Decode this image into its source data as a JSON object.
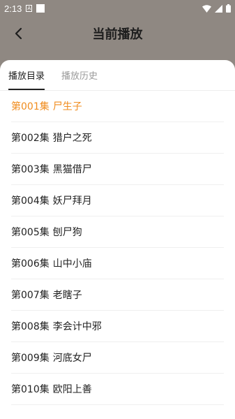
{
  "status_bar": {
    "time": "2:13",
    "notification_letter": "A"
  },
  "header": {
    "title": "当前播放",
    "back_icon": "chevron-left-icon"
  },
  "tabs": [
    {
      "label": "播放目录",
      "active": true
    },
    {
      "label": "播放历史",
      "active": false
    }
  ],
  "colors": {
    "accent": "#f08c1e",
    "text": "#222222",
    "inactive_tab": "#9a9a9a"
  },
  "episodes": [
    {
      "number": "第001集",
      "title": "尸生子",
      "current": true
    },
    {
      "number": "第002集",
      "title": "猎户之死",
      "current": false
    },
    {
      "number": "第003集",
      "title": "黑猫借尸",
      "current": false
    },
    {
      "number": "第004集",
      "title": "妖尸拜月",
      "current": false
    },
    {
      "number": "第005集",
      "title": "刨尸狗",
      "current": false
    },
    {
      "number": "第006集",
      "title": "山中小庙",
      "current": false
    },
    {
      "number": "第007集",
      "title": "老瞎子",
      "current": false
    },
    {
      "number": "第008集",
      "title": "李会计中邪",
      "current": false
    },
    {
      "number": "第009集",
      "title": "河底女尸",
      "current": false
    },
    {
      "number": "第010集",
      "title": "欧阳上善",
      "current": false
    }
  ]
}
